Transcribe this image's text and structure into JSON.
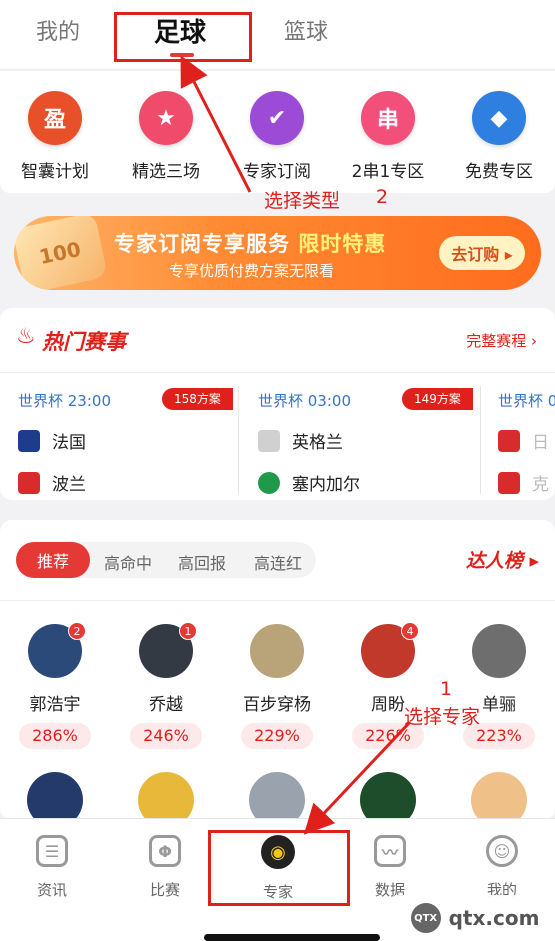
{
  "top_tabs": [
    {
      "label": "我的"
    },
    {
      "label": "足球"
    },
    {
      "label": "篮球"
    }
  ],
  "categories": [
    {
      "label": "智囊计划",
      "icon": "盈",
      "icon_name": "zhinang-icon",
      "color": "#e8502a"
    },
    {
      "label": "精选三场",
      "icon": "★",
      "icon_name": "star-icon",
      "color": "#f04b6a"
    },
    {
      "label": "专家订阅",
      "icon": "✔",
      "icon_name": "expert-subscribe-icon",
      "color": "#9b4bd6"
    },
    {
      "label": "2串1专区",
      "icon": "串",
      "icon_name": "parlay-icon",
      "color": "#f2507a"
    },
    {
      "label": "免费专区",
      "icon": "◆",
      "icon_name": "free-tag-icon",
      "color": "#2f7fe0"
    }
  ],
  "annotations": {
    "select_type": "选择类型",
    "select_type_num": "2",
    "select_expert": "选择专家",
    "select_expert_num": "1"
  },
  "banner": {
    "title_main": "专家订阅专享服务",
    "title_highlight": "限时特惠",
    "subtitle": "专享优质付费方案无限看",
    "button": "去订购 ▸",
    "coin_text": "100"
  },
  "hot": {
    "title": "热门赛事",
    "more": "完整赛程"
  },
  "matches": [
    {
      "league": "世界杯 23:00",
      "badge": "158方案",
      "home": "法国",
      "away": "波兰",
      "home_color": "#1e3c8c",
      "away_color": "#d92b2b"
    },
    {
      "league": "世界杯 03:00",
      "badge": "149方案",
      "home": "英格兰",
      "away": "塞内加尔",
      "home_color": "#c9c9c9",
      "away_color": "#1f9a49"
    },
    {
      "league": "世界杯 0",
      "badge": "",
      "home": "日",
      "away": "克",
      "home_color": "#d92b2b",
      "away_color": "#d92b2b"
    }
  ],
  "filters": {
    "active": "推荐",
    "items": [
      "高命中",
      "高回报",
      "高连红"
    ]
  },
  "rank_label": "达人榜 ▸",
  "experts": [
    {
      "name": "郭浩宇",
      "rate": "286%",
      "badge": "2",
      "color": "#2b4a7a"
    },
    {
      "name": "乔越",
      "rate": "246%",
      "badge": "1",
      "color": "#333a44"
    },
    {
      "name": "百步穿杨",
      "rate": "229%",
      "badge": "",
      "color": "#b9a47a"
    },
    {
      "name": "周盼",
      "rate": "226%",
      "badge": "4",
      "color": "#c0392b"
    },
    {
      "name": "单骊",
      "rate": "223%",
      "badge": "",
      "color": "#6e6e6e"
    }
  ],
  "second_row_colors": [
    "#233a6b",
    "#e7b83a",
    "#9aa3ad",
    "#1d4d2a",
    "#f0c089"
  ],
  "nav": [
    {
      "label": "资讯",
      "icon": "☰",
      "icon_name": "news-icon"
    },
    {
      "label": "比赛",
      "icon": "Φ",
      "icon_name": "match-icon"
    },
    {
      "label": "专家",
      "icon": "◉",
      "icon_name": "expert-icon"
    },
    {
      "label": "数据",
      "icon": "〰",
      "icon_name": "data-icon"
    },
    {
      "label": "我的",
      "icon": "☺",
      "icon_name": "profile-icon"
    }
  ],
  "watermark": "qtx.com",
  "watermark_icon": "QTX"
}
